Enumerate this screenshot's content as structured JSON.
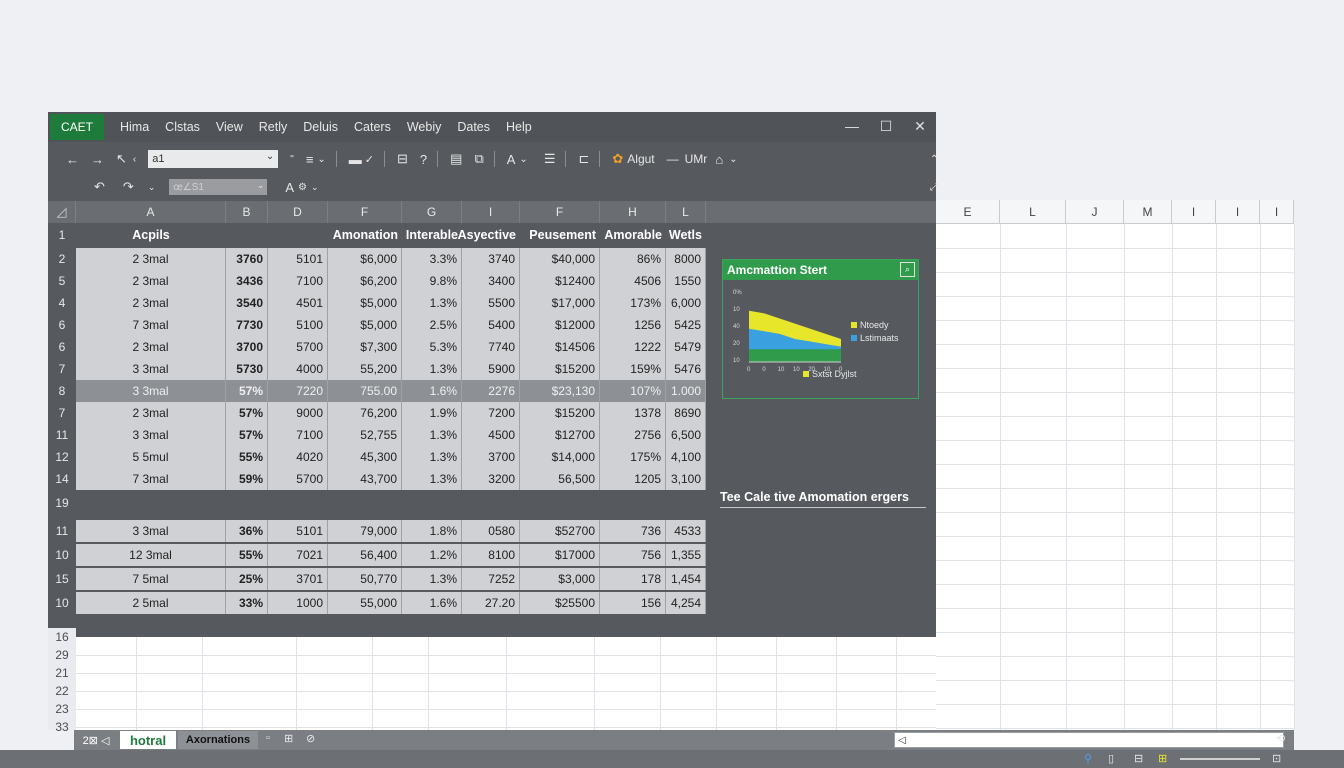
{
  "app": {
    "badge": "CAET",
    "menu": [
      "Hima",
      "Clstas",
      "View",
      "Retly",
      "Deluis",
      "Caters",
      "Webiy",
      "Dates",
      "Help"
    ],
    "window_controls": {
      "minimize": "—",
      "maximize": "☐",
      "close": "✕"
    }
  },
  "toolbar": {
    "back": "←",
    "forward": "→",
    "namebox_value": "a1",
    "account_label": "Algut",
    "user_label": "UMr",
    "pin": "⌃"
  },
  "toolbar2": {
    "font_value": "œ∠S1",
    "font_size_symbol": "A"
  },
  "columns_dark": [
    "A",
    "B",
    "D",
    "F",
    "G",
    "I",
    "F",
    "H",
    "L"
  ],
  "columns_light": [
    "E",
    "L",
    "J",
    "M",
    "I",
    "I",
    "I"
  ],
  "header_row": {
    "rownum": "1",
    "cells": [
      "Acpils",
      "",
      "",
      "Amonation",
      "Interable",
      "Asyective",
      "Peusement",
      "Amorable",
      "Wetls"
    ]
  },
  "rows": [
    {
      "rownum": "2",
      "cells": [
        "2 3mal",
        "3760",
        "5101",
        "$6,000",
        "3.3%",
        "3740",
        "$40,000",
        "86%",
        "8000"
      ]
    },
    {
      "rownum": "5",
      "cells": [
        "2 3mal",
        "3436",
        "7100",
        "$6,200",
        "9.8%",
        "3400",
        "$12400",
        "4506",
        "1550"
      ]
    },
    {
      "rownum": "4",
      "cells": [
        "2 3mal",
        "3540",
        "4501",
        "$5,000",
        "1.3%",
        "5500",
        "$17,000",
        "173%",
        "6,000"
      ]
    },
    {
      "rownum": "6",
      "cells": [
        "7 3mal",
        "7730",
        "5100",
        "$5,000",
        "2.5%",
        "5400",
        "$12000",
        "1256",
        "5425"
      ]
    },
    {
      "rownum": "6",
      "cells": [
        "2 3mal",
        "3700",
        "5700",
        "$7,300",
        "5.3%",
        "7740",
        "$14506",
        "1222",
        "5479"
      ]
    },
    {
      "rownum": "7",
      "cells": [
        "3 3mal",
        "5730",
        "4000",
        "55,200",
        "1.3%",
        "5900",
        "$15200",
        "159%",
        "5476"
      ]
    },
    {
      "rownum": "8",
      "dark": true,
      "cells": [
        "3 3mal",
        "57%",
        "7220",
        "755.00",
        "1.6%",
        "2276",
        "$23,130",
        "107%",
        "1.000"
      ]
    },
    {
      "rownum": "7",
      "cells": [
        "2 3mal",
        "57%",
        "9000",
        "76,200",
        "1.9%",
        "7200",
        "$15200",
        "1378",
        "8690"
      ]
    },
    {
      "rownum": "11",
      "cells": [
        "3 3mal",
        "57%",
        "7100",
        "52,755",
        "1.3%",
        "4500",
        "$12700",
        "2756",
        "6,500"
      ]
    },
    {
      "rownum": "12",
      "cells": [
        "5 5mul",
        "55%",
        "4020",
        "45,300",
        "1.3%",
        "3700",
        "$14,000",
        "175%",
        "4,100"
      ]
    },
    {
      "rownum": "14",
      "cells": [
        "7 3mal",
        "59%",
        "5700",
        "43,700",
        "1.3%",
        "3200",
        "56,500",
        "1205",
        "3,100"
      ]
    }
  ],
  "gap_row": {
    "rownum": "19"
  },
  "rows_lower": [
    {
      "rownum": "11",
      "cells": [
        "3 3mal",
        "36%",
        "5101",
        "79,000",
        "1.8%",
        "0580",
        "$52700",
        "736",
        "4533"
      ]
    },
    {
      "rownum": "10",
      "cells": [
        "12 3mal",
        "55%",
        "7021",
        "56,400",
        "1.2%",
        "8100",
        "$17000",
        "756",
        "1,355"
      ]
    },
    {
      "rownum": "15",
      "cells": [
        "7 5mal",
        "25%",
        "3701",
        "50,770",
        "1.3%",
        "7252",
        "$3,000",
        "178",
        "1,454"
      ]
    },
    {
      "rownum": "10",
      "cells": [
        "2 5mal",
        "33%",
        "1000",
        "55,000",
        "1.6%",
        "27.20",
        "$25500",
        "156",
        "4,254"
      ]
    }
  ],
  "rownums_light": [
    "16",
    "29",
    "21",
    "22",
    "23",
    "33"
  ],
  "chart": {
    "title": "Amcmattion Stert",
    "y_ticks": [
      "0%",
      "10",
      "40",
      "20",
      "10"
    ],
    "x_ticks": [
      "0",
      "0",
      "10",
      "10",
      "20",
      "10",
      "0"
    ],
    "colors": {
      "yellow": "#e8e62a",
      "blue": "#3aa0e0",
      "green": "#2f9b4b"
    }
  },
  "chart_data": {
    "type": "area",
    "title": "Amcmattion Stert",
    "legend": [
      "Ntoedy",
      "Lstimaats",
      "Sxtst Dyjlst"
    ],
    "series": [
      {
        "name": "Ntoedy",
        "values": [
          20,
          19,
          17,
          15,
          13,
          11,
          9
        ]
      },
      {
        "name": "Lstimaats",
        "values": [
          13,
          12,
          11,
          9,
          8,
          7,
          6
        ]
      },
      {
        "name": "Sxtst Dyjlst",
        "values": [
          5,
          5,
          5,
          5,
          5,
          5,
          5
        ]
      }
    ],
    "x": [
      "0",
      "0",
      "10",
      "10",
      "20",
      "10",
      "0"
    ],
    "ylim": [
      0,
      25
    ],
    "legend_position": "right"
  },
  "caption": "Tee Cale tive Amomation ergers",
  "tabs": {
    "nav": "2⊠ ◁",
    "active": "hotral",
    "second": "Axornations",
    "icons": [
      "▫",
      "⊞",
      "⊘"
    ]
  },
  "scroll": {
    "left_arrow": "◁",
    "right_icon": "⟲"
  },
  "status_icons": [
    "⚲",
    "▯",
    "⊟",
    "⊞",
    "⊡"
  ]
}
